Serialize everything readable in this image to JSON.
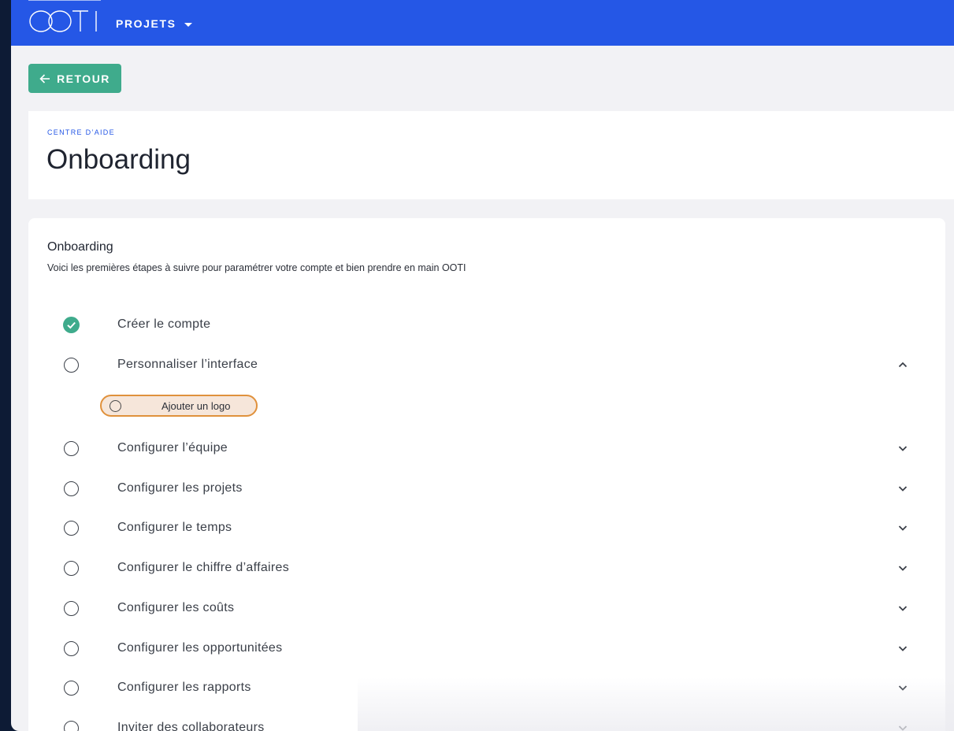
{
  "brand": {
    "logo_text": "OOTI",
    "primary": "#2557e6",
    "accent_green": "#3fab8c",
    "highlight": "#e0913c"
  },
  "nav": {
    "projets_label": "PROJETS"
  },
  "back_button": {
    "label": "RETOUR"
  },
  "header": {
    "overline": "CENTRE D’AIDE",
    "title": "Onboarding"
  },
  "section": {
    "title": "Onboarding",
    "subtitle": "Voici les premières étapes à suivre pour paramétrer votre compte et bien prendre en main OOTI"
  },
  "steps": [
    {
      "label": "Créer le compte",
      "status": "done",
      "icon": "check-circle-icon"
    },
    {
      "label": "Personnaliser l’interface",
      "status": "todo",
      "expanded": true,
      "chevron": "chevron-up-icon"
    },
    {
      "label": "Configurer l’équipe",
      "status": "todo",
      "chevron": "chevron-down-icon"
    },
    {
      "label": "Configurer les projets",
      "status": "todo",
      "chevron": "chevron-down-icon"
    },
    {
      "label": "Configurer le temps",
      "status": "todo",
      "chevron": "chevron-down-icon"
    },
    {
      "label": "Configurer le chiffre d’affaires",
      "status": "todo",
      "chevron": "chevron-down-icon"
    },
    {
      "label": "Configurer les coûts",
      "status": "todo",
      "chevron": "chevron-down-icon"
    },
    {
      "label": "Configurer les opportunitées",
      "status": "todo",
      "chevron": "chevron-down-icon"
    },
    {
      "label": "Configurer les rapports",
      "status": "todo",
      "chevron": "chevron-down-icon"
    },
    {
      "label": "Inviter des collaborateurs",
      "status": "todo",
      "chevron": "chevron-down-icon"
    }
  ],
  "substeps": [
    {
      "label": "Ajouter un logo",
      "status": "todo"
    }
  ]
}
